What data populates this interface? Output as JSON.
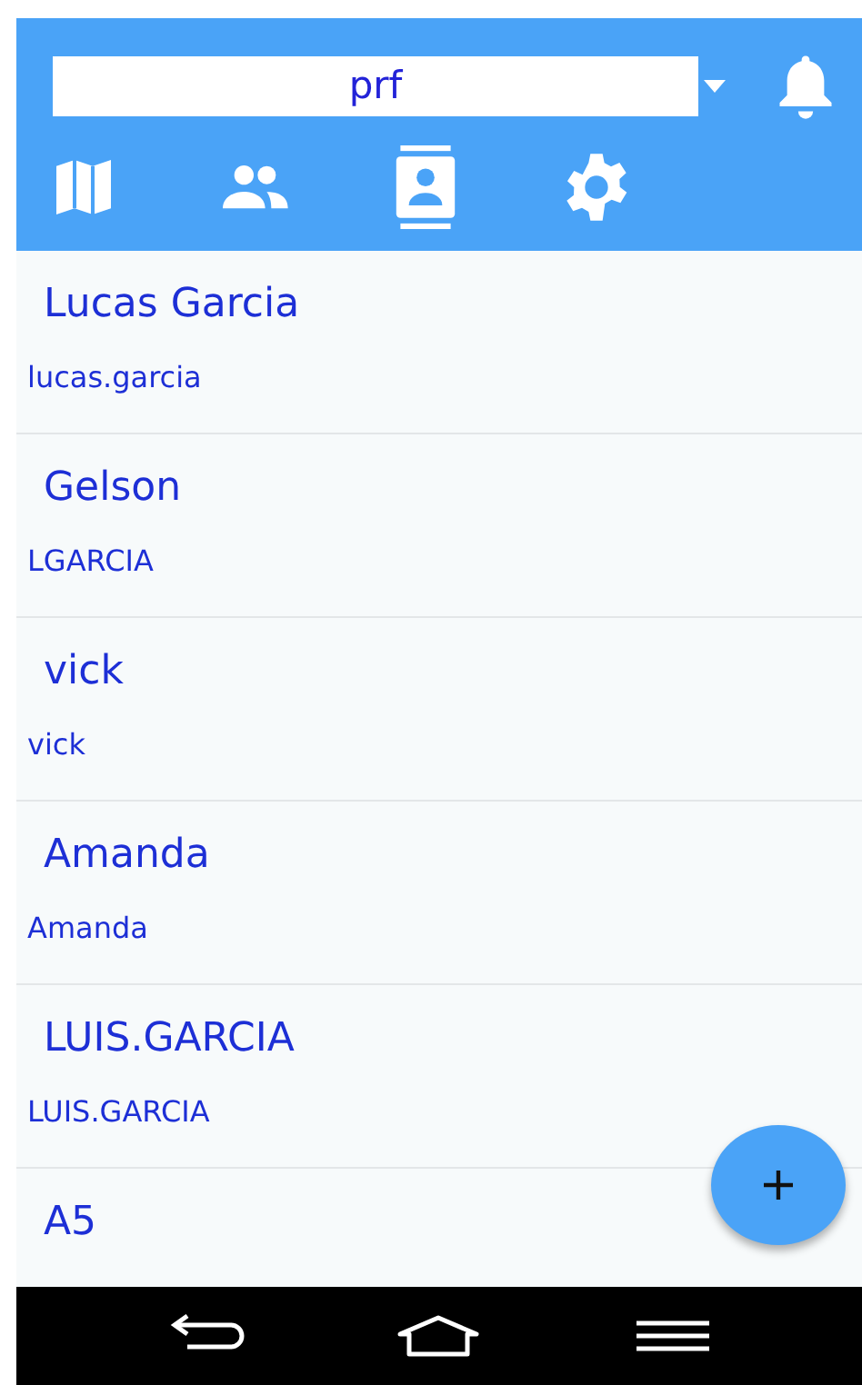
{
  "header": {
    "selector": {
      "value": "prf"
    }
  },
  "tabs": [
    {
      "kind": "map"
    },
    {
      "kind": "people"
    },
    {
      "kind": "contact"
    },
    {
      "kind": "settings"
    }
  ],
  "contacts": [
    {
      "name": "Lucas Garcia",
      "username": "lucas.garcia"
    },
    {
      "name": "Gelson",
      "username": "LGARCIA"
    },
    {
      "name": "vick",
      "username": "vick"
    },
    {
      "name": "Amanda",
      "username": "Amanda"
    },
    {
      "name": "LUIS.GARCIA",
      "username": "LUIS.GARCIA"
    },
    {
      "name": "A5"
    }
  ]
}
